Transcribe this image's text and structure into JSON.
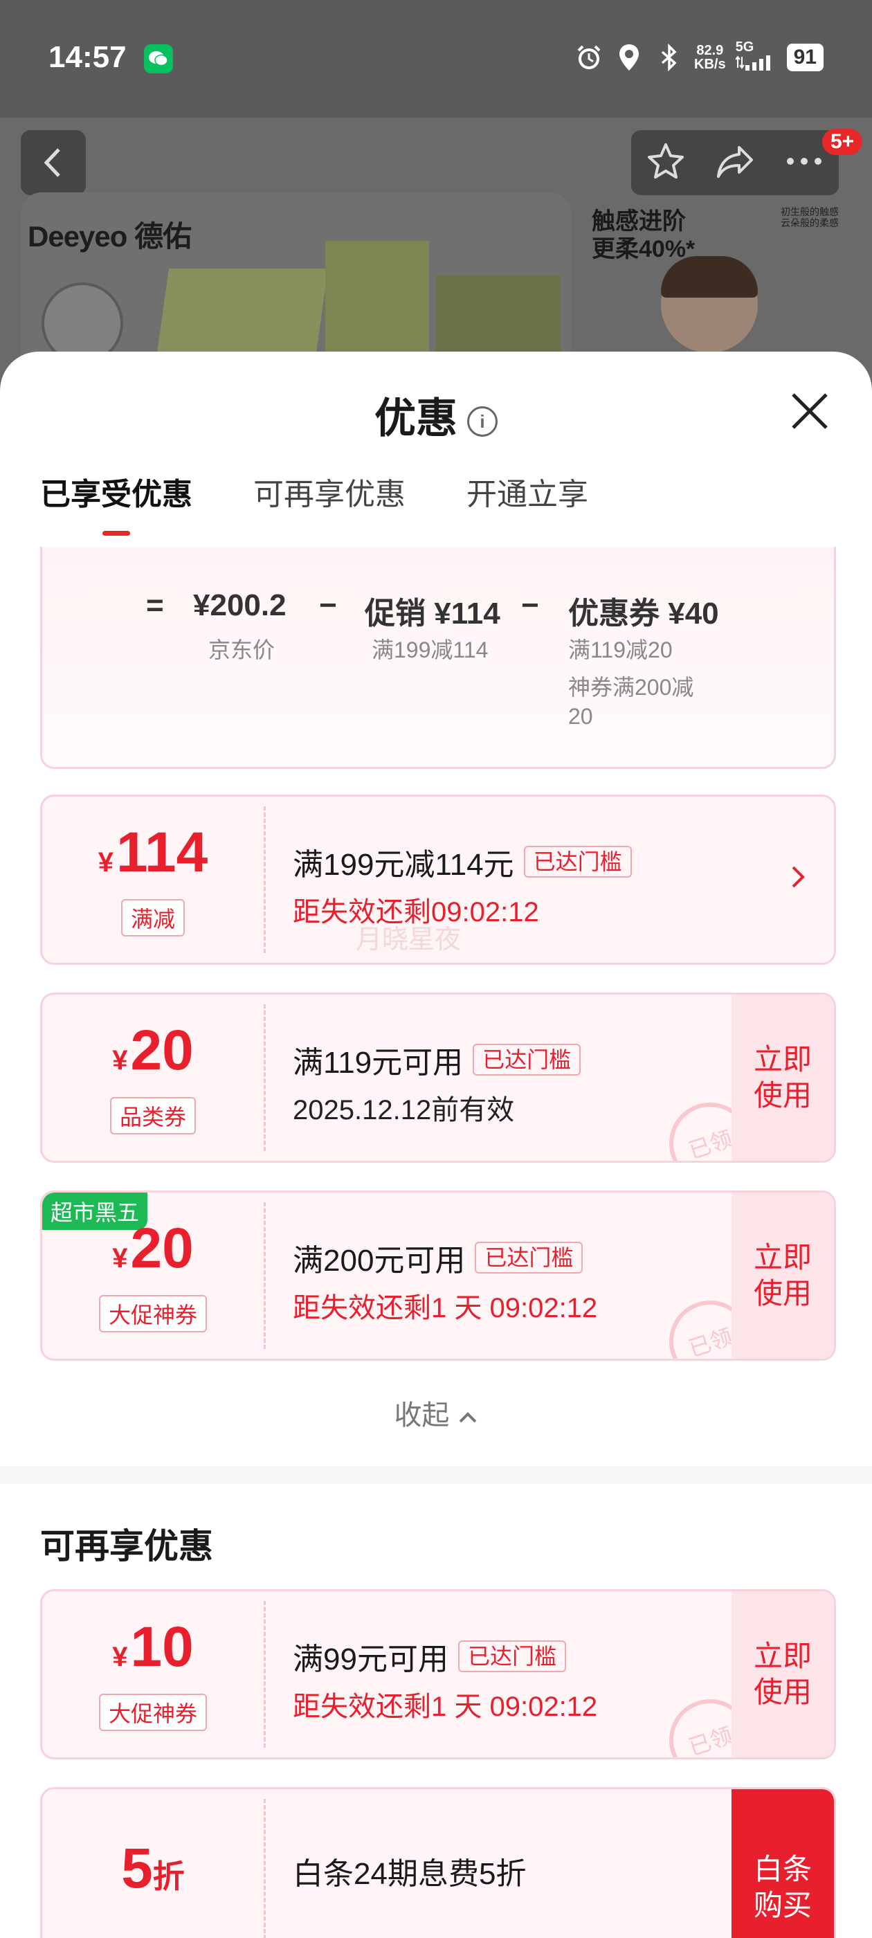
{
  "status_bar": {
    "time": "14:57",
    "net_speed_value": "82.9",
    "net_speed_unit": "KB/s",
    "network": "5G",
    "battery": "91",
    "icons": [
      "wechat-icon",
      "alarm-icon",
      "location-icon",
      "bluetooth-icon",
      "signal-icon"
    ]
  },
  "product_page": {
    "cart_badge": "5+",
    "banner_brand": "Deeyeo 德佑",
    "side_ad_line1": "触感进阶",
    "side_ad_line2": "更柔40%*",
    "side_small1": "初生般的触感",
    "side_small2": "云朵般的柔感"
  },
  "sheet": {
    "title": "优惠",
    "info_glyph": "i",
    "tabs": [
      {
        "label": "已享受优惠",
        "active": true
      },
      {
        "label": "可再享优惠",
        "active": false
      },
      {
        "label": "开通立享",
        "active": false
      }
    ],
    "calc": {
      "equals": "=",
      "price": "¥200.2",
      "price_label": "京东价",
      "minus1": "−",
      "promo": "促销 ¥114",
      "promo_sub": "满199减114",
      "minus2": "−",
      "coupon": "优惠券 ¥40",
      "coupon_sub1": "满119减20",
      "coupon_sub2": "神券满200减",
      "coupon_sub3": "20"
    },
    "watermark": "月晓星夜",
    "coupons": [
      {
        "currency": "¥",
        "amount": "114",
        "tag": "满减",
        "title": "满199元减114元",
        "threshold": "已达门槛",
        "sub": "距失效还剩09:02:12"
      },
      {
        "currency": "¥",
        "amount": "20",
        "tag": "品类券",
        "title": "满119元可用",
        "threshold": "已达门槛",
        "sub": "2025.12.12前有效",
        "button_line1": "立即",
        "button_line2": "使用",
        "stamp": "已领"
      },
      {
        "corner": "超市黑五",
        "currency": "¥",
        "amount": "20",
        "tag": "大促神券",
        "title": "满200元可用",
        "threshold": "已达门槛",
        "sub": "距失效还剩1 天 09:02:12",
        "button_line1": "立即",
        "button_line2": "使用",
        "stamp": "已领"
      }
    ],
    "collapse_label": "收起",
    "more_section_title": "可再享优惠",
    "more_coupons": [
      {
        "currency": "¥",
        "amount": "10",
        "tag": "大促神券",
        "title": "满99元可用",
        "threshold": "已达门槛",
        "sub": "距失效还剩1 天 09:02:12",
        "button_line1": "立即",
        "button_line2": "使用",
        "stamp": "已领"
      },
      {
        "amount": "5",
        "unit": "折",
        "title": "白条24期息费5折",
        "button_line1": "白条",
        "button_line2": "购买"
      }
    ]
  }
}
